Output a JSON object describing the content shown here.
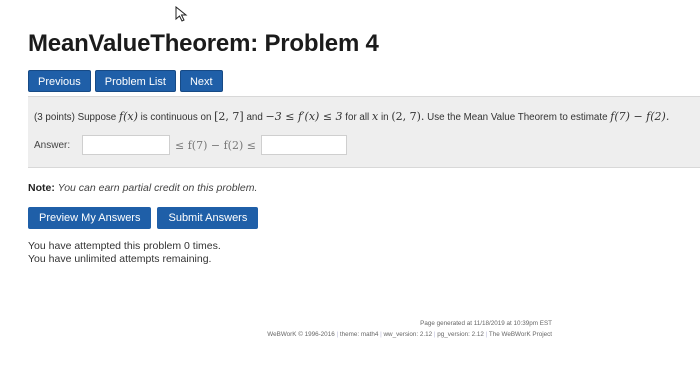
{
  "header": {
    "title": "MeanValueTheorem: Problem 4"
  },
  "nav": {
    "previous_label": "Previous",
    "problem_list_label": "Problem List",
    "next_label": "Next"
  },
  "problem": {
    "points": "(3 points)",
    "t1": "Suppose",
    "f_of_x": "f(x)",
    "t2": "is continuous on",
    "interval_closed": "[2, 7]",
    "t3": "and",
    "inequality": "−3 ≤ f′(x) ≤ 3",
    "t4": "for all",
    "x": "x",
    "t5": "in",
    "interval_open": "(2, 7).",
    "t6": "Use the Mean Value Theorem to estimate",
    "estimate": "f(7) − f(2)."
  },
  "answer": {
    "label": "Answer:",
    "between_text": "≤ f(7) − f(2) ≤",
    "lower_value": "",
    "upper_value": ""
  },
  "note": {
    "bold": "Note:",
    "text": "You can earn partial credit on this problem."
  },
  "actions": {
    "preview_label": "Preview My Answers",
    "submit_label": "Submit Answers"
  },
  "attempts": {
    "line1": "You have attempted this problem 0 times.",
    "line2": "You have unlimited attempts remaining."
  },
  "footer": {
    "generated": "Page generated at 11/18/2019 at 10:39pm EST",
    "part1": "WeBWorK © 1996-2016",
    "part2": "theme: math4",
    "part3": "ww_version: 2.12",
    "part4": "pg_version: 2.12",
    "part5": "The WeBWorK Project"
  }
}
